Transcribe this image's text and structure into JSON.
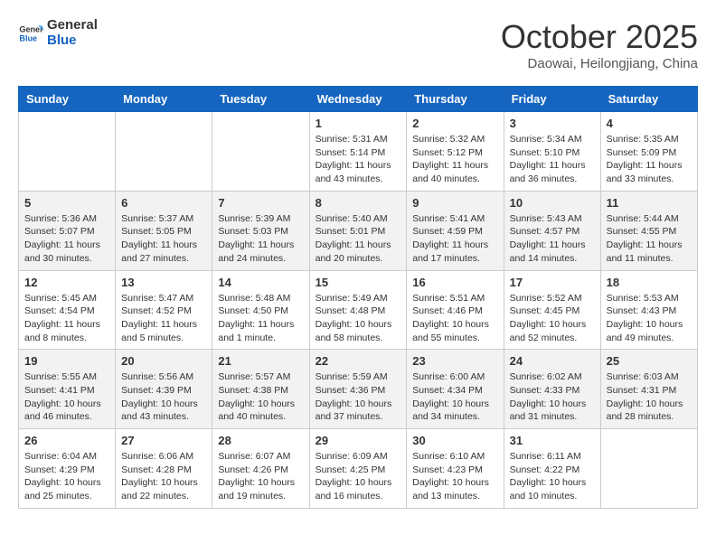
{
  "logo": {
    "line1": "General",
    "line2": "Blue"
  },
  "title": "October 2025",
  "location": "Daowai, Heilongjiang, China",
  "days_of_week": [
    "Sunday",
    "Monday",
    "Tuesday",
    "Wednesday",
    "Thursday",
    "Friday",
    "Saturday"
  ],
  "weeks": [
    [
      {
        "day": "",
        "info": ""
      },
      {
        "day": "",
        "info": ""
      },
      {
        "day": "",
        "info": ""
      },
      {
        "day": "1",
        "info": "Sunrise: 5:31 AM\nSunset: 5:14 PM\nDaylight: 11 hours and 43 minutes."
      },
      {
        "day": "2",
        "info": "Sunrise: 5:32 AM\nSunset: 5:12 PM\nDaylight: 11 hours and 40 minutes."
      },
      {
        "day": "3",
        "info": "Sunrise: 5:34 AM\nSunset: 5:10 PM\nDaylight: 11 hours and 36 minutes."
      },
      {
        "day": "4",
        "info": "Sunrise: 5:35 AM\nSunset: 5:09 PM\nDaylight: 11 hours and 33 minutes."
      }
    ],
    [
      {
        "day": "5",
        "info": "Sunrise: 5:36 AM\nSunset: 5:07 PM\nDaylight: 11 hours and 30 minutes."
      },
      {
        "day": "6",
        "info": "Sunrise: 5:37 AM\nSunset: 5:05 PM\nDaylight: 11 hours and 27 minutes."
      },
      {
        "day": "7",
        "info": "Sunrise: 5:39 AM\nSunset: 5:03 PM\nDaylight: 11 hours and 24 minutes."
      },
      {
        "day": "8",
        "info": "Sunrise: 5:40 AM\nSunset: 5:01 PM\nDaylight: 11 hours and 20 minutes."
      },
      {
        "day": "9",
        "info": "Sunrise: 5:41 AM\nSunset: 4:59 PM\nDaylight: 11 hours and 17 minutes."
      },
      {
        "day": "10",
        "info": "Sunrise: 5:43 AM\nSunset: 4:57 PM\nDaylight: 11 hours and 14 minutes."
      },
      {
        "day": "11",
        "info": "Sunrise: 5:44 AM\nSunset: 4:55 PM\nDaylight: 11 hours and 11 minutes."
      }
    ],
    [
      {
        "day": "12",
        "info": "Sunrise: 5:45 AM\nSunset: 4:54 PM\nDaylight: 11 hours and 8 minutes."
      },
      {
        "day": "13",
        "info": "Sunrise: 5:47 AM\nSunset: 4:52 PM\nDaylight: 11 hours and 5 minutes."
      },
      {
        "day": "14",
        "info": "Sunrise: 5:48 AM\nSunset: 4:50 PM\nDaylight: 11 hours and 1 minute."
      },
      {
        "day": "15",
        "info": "Sunrise: 5:49 AM\nSunset: 4:48 PM\nDaylight: 10 hours and 58 minutes."
      },
      {
        "day": "16",
        "info": "Sunrise: 5:51 AM\nSunset: 4:46 PM\nDaylight: 10 hours and 55 minutes."
      },
      {
        "day": "17",
        "info": "Sunrise: 5:52 AM\nSunset: 4:45 PM\nDaylight: 10 hours and 52 minutes."
      },
      {
        "day": "18",
        "info": "Sunrise: 5:53 AM\nSunset: 4:43 PM\nDaylight: 10 hours and 49 minutes."
      }
    ],
    [
      {
        "day": "19",
        "info": "Sunrise: 5:55 AM\nSunset: 4:41 PM\nDaylight: 10 hours and 46 minutes."
      },
      {
        "day": "20",
        "info": "Sunrise: 5:56 AM\nSunset: 4:39 PM\nDaylight: 10 hours and 43 minutes."
      },
      {
        "day": "21",
        "info": "Sunrise: 5:57 AM\nSunset: 4:38 PM\nDaylight: 10 hours and 40 minutes."
      },
      {
        "day": "22",
        "info": "Sunrise: 5:59 AM\nSunset: 4:36 PM\nDaylight: 10 hours and 37 minutes."
      },
      {
        "day": "23",
        "info": "Sunrise: 6:00 AM\nSunset: 4:34 PM\nDaylight: 10 hours and 34 minutes."
      },
      {
        "day": "24",
        "info": "Sunrise: 6:02 AM\nSunset: 4:33 PM\nDaylight: 10 hours and 31 minutes."
      },
      {
        "day": "25",
        "info": "Sunrise: 6:03 AM\nSunset: 4:31 PM\nDaylight: 10 hours and 28 minutes."
      }
    ],
    [
      {
        "day": "26",
        "info": "Sunrise: 6:04 AM\nSunset: 4:29 PM\nDaylight: 10 hours and 25 minutes."
      },
      {
        "day": "27",
        "info": "Sunrise: 6:06 AM\nSunset: 4:28 PM\nDaylight: 10 hours and 22 minutes."
      },
      {
        "day": "28",
        "info": "Sunrise: 6:07 AM\nSunset: 4:26 PM\nDaylight: 10 hours and 19 minutes."
      },
      {
        "day": "29",
        "info": "Sunrise: 6:09 AM\nSunset: 4:25 PM\nDaylight: 10 hours and 16 minutes."
      },
      {
        "day": "30",
        "info": "Sunrise: 6:10 AM\nSunset: 4:23 PM\nDaylight: 10 hours and 13 minutes."
      },
      {
        "day": "31",
        "info": "Sunrise: 6:11 AM\nSunset: 4:22 PM\nDaylight: 10 hours and 10 minutes."
      },
      {
        "day": "",
        "info": ""
      }
    ]
  ]
}
